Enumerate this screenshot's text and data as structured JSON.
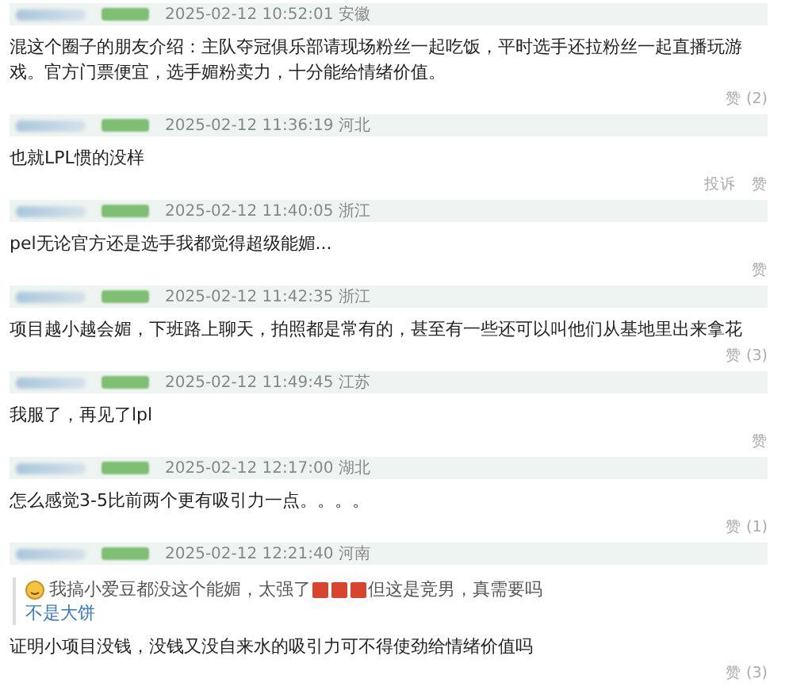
{
  "posts": [
    {
      "time": "2025-02-12 10:52:01",
      "location": "安徽",
      "body": "混这个圈子的朋友介绍：主队夺冠俱乐部请现场粉丝一起吃饭，平时选手还拉粉丝一起直播玩游戏。官方门票便宜，选手媚粉卖力，十分能给情绪价值。",
      "actions": [
        "赞 (2)"
      ]
    },
    {
      "time": "2025-02-12 11:36:19",
      "location": "河北",
      "body": "也就LPL惯的没样",
      "actions": [
        "投诉",
        "赞"
      ]
    },
    {
      "time": "2025-02-12 11:40:05",
      "location": "浙江",
      "body": "pel无论官方还是选手我都觉得超级能媚...",
      "actions": [
        "赞"
      ]
    },
    {
      "time": "2025-02-12 11:42:35",
      "location": "浙江",
      "body": "项目越小越会媚，下班路上聊天，拍照都是常有的，甚至有一些还可以叫他们从基地里出来拿花",
      "actions": [
        "赞 (3)"
      ]
    },
    {
      "time": "2025-02-12 11:49:45",
      "location": "江苏",
      "body": "我服了，再见了lpl",
      "actions": [
        "赞"
      ]
    },
    {
      "time": "2025-02-12 12:17:00",
      "location": "湖北",
      "body": "怎么感觉3-5比前两个更有吸引力一点。。。。",
      "actions": [
        "赞 (1)"
      ]
    },
    {
      "time": "2025-02-12 12:21:40",
      "location": "河南",
      "quote": {
        "before": "我搞小爱豆都没这个能媚，太强了",
        "after": "但这是竞男，真需要吗",
        "author": "不是大饼"
      },
      "body": "证明小项目没钱，没钱又没自来水的吸引力可不得使劲给情绪价值吗",
      "actions": [
        "赞 (3)"
      ]
    }
  ]
}
